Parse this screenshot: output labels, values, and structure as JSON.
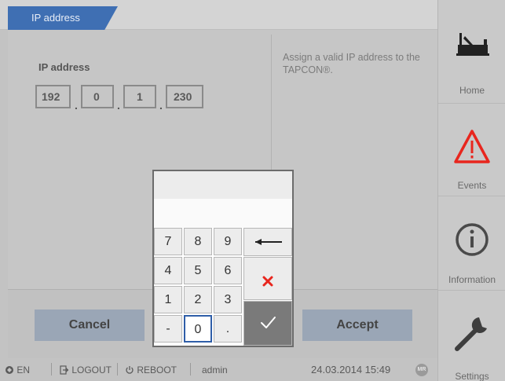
{
  "tab": {
    "label": "IP address"
  },
  "form": {
    "ip_label": "IP address",
    "octets": [
      "192",
      "0",
      "1",
      "230"
    ],
    "separator": "."
  },
  "help": {
    "text": "Assign a valid IP address to the TAPCON®."
  },
  "buttons": {
    "cancel": "Cancel",
    "accept": "Accept"
  },
  "keypad": {
    "keys": [
      "7",
      "8",
      "9",
      "4",
      "5",
      "6",
      "1",
      "2",
      "3",
      "-",
      "0",
      "."
    ],
    "selected_key": "0",
    "backspace_icon": "arrow-left-icon",
    "clear_icon": "x-icon",
    "confirm_icon": "checkmark-icon",
    "clear_color": "#e8261e"
  },
  "statusbar": {
    "language": "EN",
    "logout": "LOGOUT",
    "reboot": "REBOOT",
    "user": "admin",
    "datetime": "24.03.2014 15:49",
    "badge": "MR"
  },
  "sidebar": {
    "items": [
      {
        "label": "Home",
        "icon": "device-home-icon"
      },
      {
        "label": "Events",
        "icon": "warning-triangle-icon"
      },
      {
        "label": "Information",
        "icon": "info-circle-icon"
      },
      {
        "label": "Settings",
        "icon": "wrench-icon"
      }
    ]
  },
  "colors": {
    "accent": "#3f6fb3",
    "warning": "#e8261e"
  }
}
